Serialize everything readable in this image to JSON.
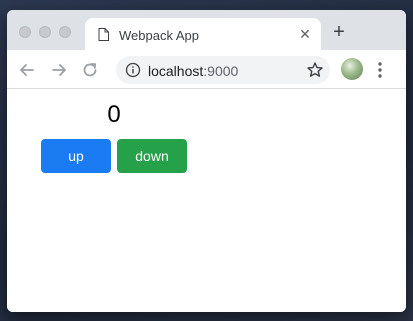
{
  "browser": {
    "tab": {
      "title": "Webpack App",
      "close_glyph": "✕"
    },
    "new_tab_glyph": "+",
    "address": {
      "host": "localhost",
      "port": ":9000"
    },
    "icons": {
      "tab": "document-icon",
      "back": "arrow-left-icon",
      "forward": "arrow-right-icon",
      "reload": "reload-icon",
      "info": "info-icon",
      "bookmark": "star-icon",
      "menu": "kebab-menu-icon"
    }
  },
  "app": {
    "count": "0",
    "buttons": {
      "up": {
        "label": "up",
        "color": "#1a7bf2"
      },
      "down": {
        "label": "down",
        "color": "#25a14a"
      }
    }
  }
}
